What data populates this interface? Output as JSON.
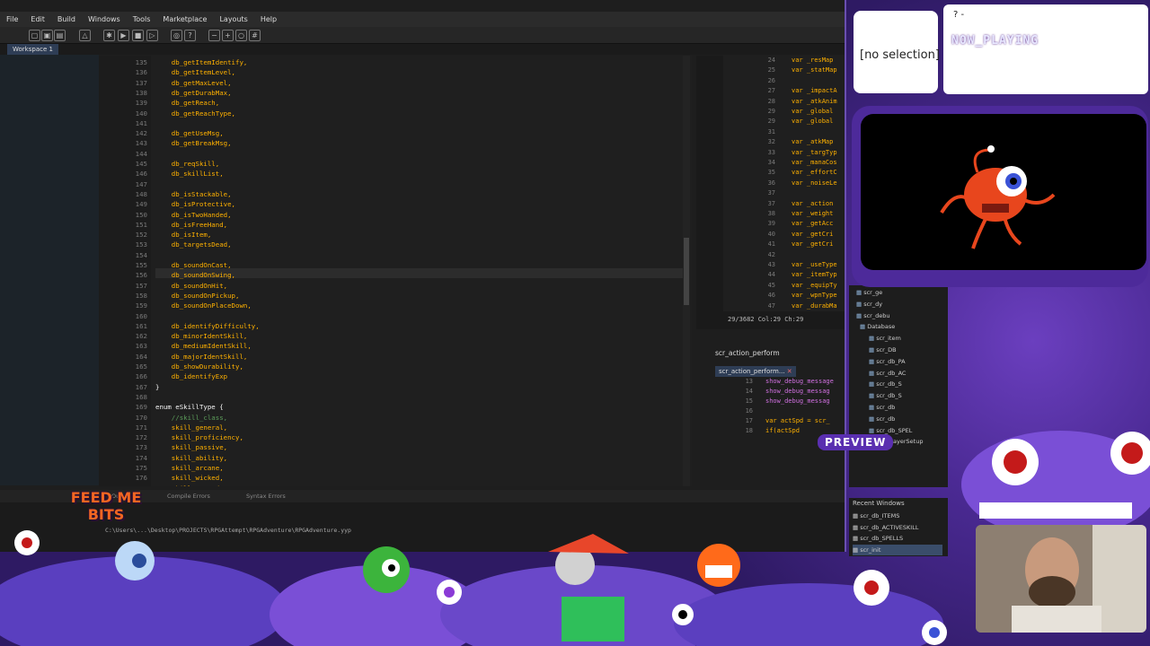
{
  "ide": {
    "menu": [
      "File",
      "Edit",
      "Build",
      "Windows",
      "Tools",
      "Marketplace",
      "Layouts",
      "Help"
    ],
    "workspace_tab": "Workspace 1",
    "code_lines": [
      {
        "n": "135",
        "t": "    db_getItemIdentify,"
      },
      {
        "n": "136",
        "t": "    db_getItemLevel,"
      },
      {
        "n": "137",
        "t": "    db_getMaxLevel,"
      },
      {
        "n": "138",
        "t": "    db_getDurabMax,"
      },
      {
        "n": "139",
        "t": "    db_getReach,"
      },
      {
        "n": "140",
        "t": "    db_getReachType,"
      },
      {
        "n": "141",
        "t": ""
      },
      {
        "n": "142",
        "t": "    db_getUseMsg,"
      },
      {
        "n": "143",
        "t": "    db_getBreakMsg,"
      },
      {
        "n": "144",
        "t": ""
      },
      {
        "n": "145",
        "t": "    db_reqSkill,"
      },
      {
        "n": "146",
        "t": "    db_skillList,"
      },
      {
        "n": "147",
        "t": ""
      },
      {
        "n": "148",
        "t": "    db_isStackable,"
      },
      {
        "n": "149",
        "t": "    db_isProtective,"
      },
      {
        "n": "150",
        "t": "    db_isTwoHanded,"
      },
      {
        "n": "151",
        "t": "    db_isFreeHand,"
      },
      {
        "n": "152",
        "t": "    db_isItem,"
      },
      {
        "n": "153",
        "t": "    db_targetsDead,"
      },
      {
        "n": "154",
        "t": ""
      },
      {
        "n": "155",
        "t": "    db_soundOnCast,"
      },
      {
        "n": "156",
        "t": "    db_soundOnSwing,"
      },
      {
        "n": "157",
        "t": "    db_soundOnHit,"
      },
      {
        "n": "158",
        "t": "    db_soundOnPickup,"
      },
      {
        "n": "159",
        "t": "    db_soundOnPlaceDown,"
      },
      {
        "n": "160",
        "t": ""
      },
      {
        "n": "161",
        "t": "    db_identifyDifficulty,"
      },
      {
        "n": "162",
        "t": "    db_minorIdentSkill,"
      },
      {
        "n": "163",
        "t": "    db_mediumIdentSkill,"
      },
      {
        "n": "164",
        "t": "    db_majorIdentSkill,"
      },
      {
        "n": "165",
        "t": "    db_showDurability,"
      },
      {
        "n": "166",
        "t": "    db_identifyExp"
      },
      {
        "n": "167",
        "t": "}"
      },
      {
        "n": "168",
        "t": ""
      },
      {
        "n": "169",
        "t": "enum eSkillType {"
      },
      {
        "n": "170",
        "t": "    //skill_class,"
      },
      {
        "n": "171",
        "t": "    skill_general,"
      },
      {
        "n": "172",
        "t": "    skill_proficiency,"
      },
      {
        "n": "173",
        "t": "    skill_passive,"
      },
      {
        "n": "174",
        "t": "    skill_ability,"
      },
      {
        "n": "175",
        "t": "    skill_arcane,"
      },
      {
        "n": "176",
        "t": "    skill_wicked,"
      },
      {
        "n": "177",
        "t": "    skill_sacred,"
      }
    ],
    "right_code": [
      {
        "n": "24",
        "t": "var _resMap"
      },
      {
        "n": "25",
        "t": "var _statMap"
      },
      {
        "n": "26",
        "t": ""
      },
      {
        "n": "27",
        "t": "var _impactA"
      },
      {
        "n": "28",
        "t": "var _atkAnim"
      },
      {
        "n": "29",
        "t": "var _global"
      },
      {
        "n": "29",
        "t": "var _global"
      },
      {
        "n": "31",
        "t": ""
      },
      {
        "n": "32",
        "t": "var _atkMap"
      },
      {
        "n": "33",
        "t": "var _targTyp"
      },
      {
        "n": "34",
        "t": "var _manaCos"
      },
      {
        "n": "35",
        "t": "var _effortC"
      },
      {
        "n": "36",
        "t": "var _noiseLe"
      },
      {
        "n": "37",
        "t": ""
      },
      {
        "n": "37",
        "t": "var _action"
      },
      {
        "n": "38",
        "t": "var _weight"
      },
      {
        "n": "39",
        "t": "var _getAcc"
      },
      {
        "n": "40",
        "t": "var _getCri"
      },
      {
        "n": "41",
        "t": "var _getCri"
      },
      {
        "n": "42",
        "t": ""
      },
      {
        "n": "43",
        "t": "var _useType"
      },
      {
        "n": "44",
        "t": "var _itemTyp"
      },
      {
        "n": "45",
        "t": "var _equipTy"
      },
      {
        "n": "46",
        "t": "var _wpnType"
      },
      {
        "n": "47",
        "t": "var _durabMa"
      }
    ],
    "right_status": "29/3682 Col:29 Ch:29",
    "action_window_title": "scr_action_perform",
    "action_tab": "scr_action_perform...",
    "action_code": [
      {
        "n": "13",
        "t": "show_debug_message"
      },
      {
        "n": "14",
        "t": "show_debug_messag"
      },
      {
        "n": "15",
        "t": "show_debug_messag"
      },
      {
        "n": "16",
        "t": ""
      },
      {
        "n": "17",
        "t": "var actSpd = scr_"
      },
      {
        "n": "18",
        "t": "if(actSpd"
      }
    ],
    "tree_items": [
      "scr_ge",
      "scr_dy",
      "scr_debu",
      "Database",
      "scr_item",
      "scr_DB",
      "scr_db_PA",
      "scr_db_AC",
      "scr_db_S",
      "scr_db_S",
      "scr_db",
      "scr_db",
      "scr_db_SPEL",
      "scr_playerSetup"
    ],
    "recent_title": "Recent Windows",
    "recent_items": [
      "scr_db_ITEMS",
      "scr_db_ACTIVESKILL",
      "scr_db_SPELLS",
      "scr_init"
    ],
    "bottom_tabs": [
      "Output",
      "Compile Errors",
      "Syntax Errors"
    ],
    "output_path": "C:\\Users\\...\\Desktop\\PROJECTS\\RPGAttempt\\RPGAdventure\\RPGAdventure.yyp"
  },
  "overlay": {
    "selection": "[no selection]",
    "now_playing_q": "? -",
    "now_playing": "NOW_PLAYING",
    "preview_label": "PREVIEW",
    "logo_line1": "FEED ME",
    "logo_line2": "BITS"
  },
  "colors": {
    "accent_purple": "#6b3fbf",
    "code_orange": "#ffb100"
  }
}
